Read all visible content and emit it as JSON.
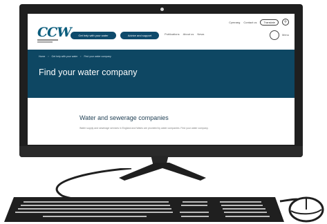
{
  "site": {
    "logo_text": "CCW",
    "utility": {
      "link_1": "Cymraeg",
      "link_2": "Contact us",
      "link_3": "Translate",
      "search_label": "Search"
    },
    "nav": {
      "button_1": "Get help with your water",
      "button_2": "Advice and support",
      "link_1": "Publications",
      "link_2": "About us",
      "link_3": "News",
      "menu_label": "Menu"
    },
    "breadcrumb": [
      "Home",
      "Get help with your water",
      "Find your water company"
    ],
    "hero_title": "Find your water company",
    "section_title": "Water and sewerage companies",
    "section_body": "Water supply and sewerage services in England and Wales are provided by water companies. Find your water company."
  },
  "icons": {
    "camera": "webcam-dot",
    "search": "search-icon",
    "menu": "menu-circle-icon"
  },
  "colors": {
    "brand_navy": "#0e4763",
    "brand_teal": "#0b5d7d",
    "button": "#0e4a6b",
    "device_body": "#1f1f1f"
  }
}
